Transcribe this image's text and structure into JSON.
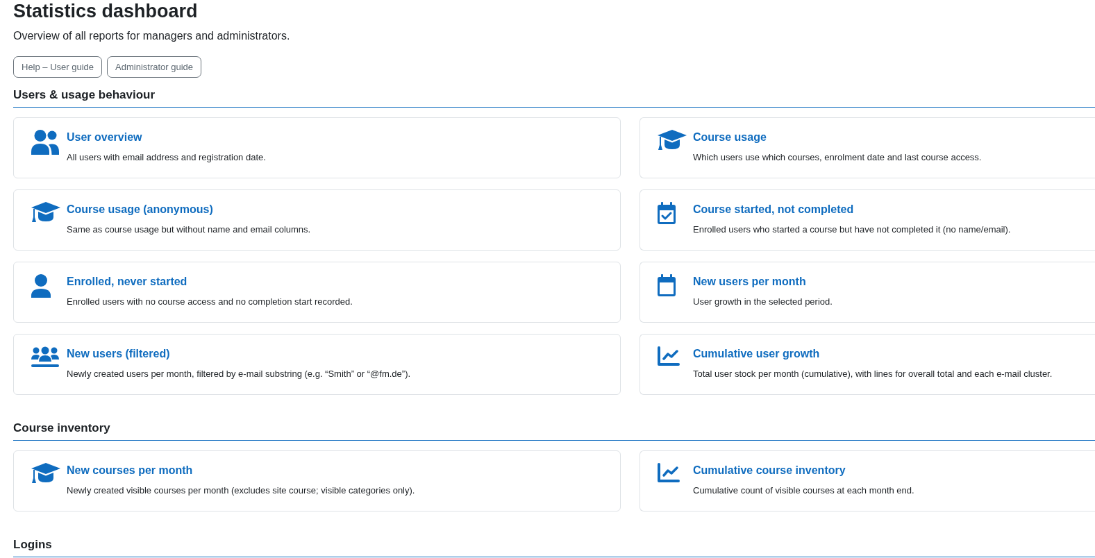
{
  "page": {
    "title": "Statistics dashboard",
    "subtitle": "Overview of all reports for managers and administrators."
  },
  "buttons": [
    {
      "label": "Help – User guide"
    },
    {
      "label": "Administrator guide"
    }
  ],
  "sections": [
    {
      "heading": "Users & usage behaviour",
      "reports": [
        {
          "kind": "users",
          "title": "User overview",
          "description": "All users with email address and registration date."
        },
        {
          "kind": "cap",
          "title": "Course usage",
          "description": "Which users use which courses, enrolment date and last course access."
        },
        {
          "kind": "cap",
          "title": "Course usage (anonymous)",
          "description": "Same as course usage but without name and email columns."
        },
        {
          "kind": "calendar-check",
          "title": "Course started, not completed",
          "description": "Enrolled users who started a course but have not completed it (no name/email)."
        },
        {
          "kind": "user",
          "title": "Enrolled, never started",
          "description": "Enrolled users with no course access and no completion start recorded."
        },
        {
          "kind": "calendar",
          "title": "New users per month",
          "description": "User growth in the selected period."
        },
        {
          "kind": "group",
          "title": "New users (filtered)",
          "description": "Newly created users per month, filtered by e-mail substring (e.g. “Smith” or “@fm.de”)."
        },
        {
          "kind": "chart",
          "title": "Cumulative user growth",
          "description": "Total user stock per month (cumulative), with lines for overall total and each e-mail cluster."
        }
      ]
    },
    {
      "heading": "Course inventory",
      "reports": [
        {
          "kind": "cap",
          "title": "New courses per month",
          "description": "Newly created visible courses per month (excludes site course; visible categories only)."
        },
        {
          "kind": "chart",
          "title": "Cumulative course inventory",
          "description": "Cumulative count of visible courses at each month end."
        }
      ]
    },
    {
      "heading": "Logins"
    }
  ]
}
